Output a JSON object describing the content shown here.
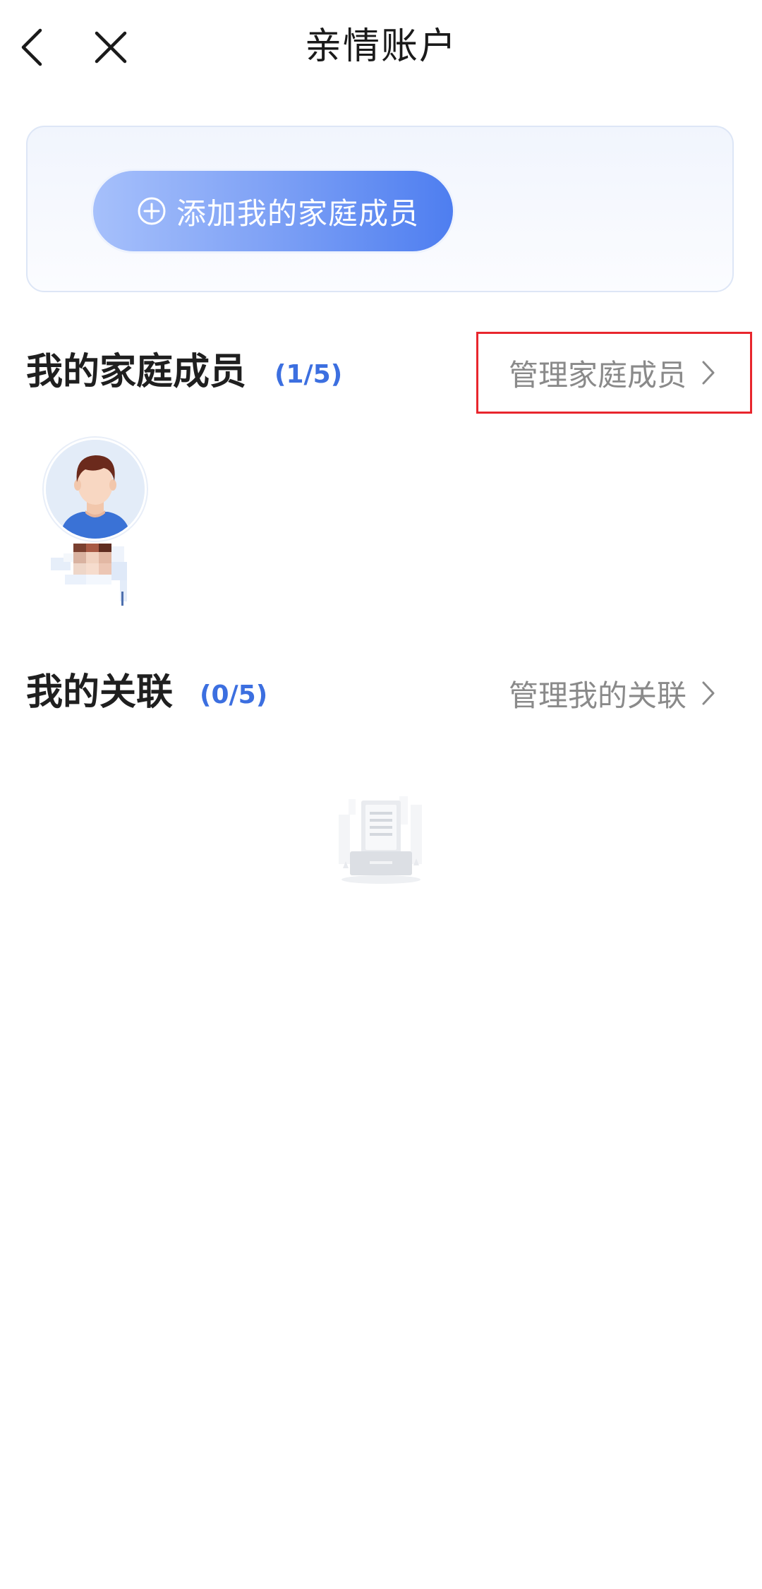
{
  "header": {
    "title": "亲情账户",
    "back_icon": "chevron-left-icon",
    "close_icon": "close-icon"
  },
  "add_card": {
    "button_label": "添加我的家庭成员",
    "button_icon": "plus-circle-icon"
  },
  "family_section": {
    "title": "我的家庭成员",
    "count": "(1/5)",
    "manage_label": "管理家庭成员",
    "members": [
      {
        "avatar": "male-avatar-icon",
        "name_obscured": true
      }
    ]
  },
  "linked_section": {
    "title": "我的关联",
    "count": "(0/5)",
    "manage_label": "管理我的关联",
    "empty_icon": "empty-document-icon"
  },
  "colors": {
    "accent": "#3c6fe0",
    "button_gradient_start": "#a6c0fb",
    "button_gradient_end": "#4e7ef0",
    "highlight": "#e8262d",
    "muted_text": "#8a8a8a"
  }
}
